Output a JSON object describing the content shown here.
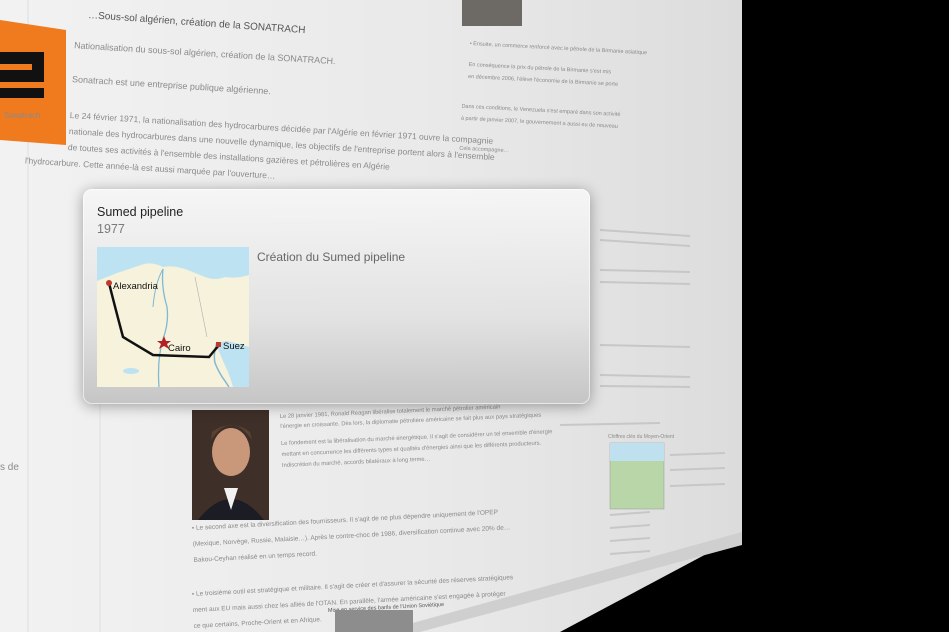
{
  "background": {
    "header_line": "…Sous-sol algérien, création de la SONATRACH",
    "logo_text": "Sonatrach",
    "paragraph_heading": "Nationalisation du sous-sol algérien, création de la SONATRACH.",
    "paragraph_intro": "Sonatrach est une entreprise publique algérienne.",
    "paragraph_lines": [
      "Le 24 février 1971, la nationalisation des hydrocarbures décidée par l'Algérie en février 1971 ouvre la compagnie",
      "nationale des hydrocarbures dans une nouvelle dynamique, les objectifs de l'entreprise portent alors à l'ensemble",
      "de toutes ses activités à l'ensemble des installations gazières et pétrolières en Algérie",
      "l'hydrocarbure. Cette année-là est aussi marquée par l'ouverture…"
    ],
    "reagan_lines": [
      "Le 28 janvier 1981, Ronald Reagan libéralise totalement le marché pétrolier américain",
      "l'énergie en croissante. Dès lors, la diplomatie pétrolière américaine se fait plus aux pays stratégiques",
      "Le fondement est la libéralisation du marché énergétique. Il s'agit de considérer un tel ensemble d'énergie",
      "mettant en concurrence les différents types et qualités d'énergies ainsi que les différents producteurs.",
      "Indiscrétion du marché, accords bilatéraux à long terme…"
    ],
    "bullet_lines_1": [
      "• Le second axe est la diversification des fournisseurs. Il s'agit de ne plus dépendre uniquement de l'OPEP",
      "(Mexique, Norvège, Russie, Malaisie…). Après le contre-choc de 1986, diversification continue avec 20% de…",
      "Bakou-Ceyhan réalisé en un temps record."
    ],
    "bullet_lines_2": [
      "• Le troisième outil est stratégique et militaire. Il s'agit de créer et d'assurer la sécurité des réserves stratégiques",
      "ment aux EU mais aussi chez les alliés de l'OTAN. En parallèle, l'armée américaine s'est engagée à protéger",
      "ce que certains, Proche-Orient et en Afrique."
    ],
    "right_col_lines": [
      "• Ensuite, un commerce renforcé avec le pétrole de la Birmanie asiatique",
      "En conséquence la prix du pétrole de la Birmanie s'est mis",
      "en décembre 2006, l'élève l'économie de la Birmanie se porte",
      "Dans ces conditions, le Venezuela s'est emparé dans son activité",
      "à partir de janvier 2007, le gouvernement a aussi eu de nouveau",
      "Cela accompagne…"
    ],
    "side_chart_caption": "Chiffres clés du Moyen-Orient",
    "small_caption": "Mise en service des barils de l'Union Soviétique",
    "left_edge_text": "s de"
  },
  "card": {
    "title": "Sumed pipeline",
    "year": "1977",
    "description": "Création du Sumed pipeline",
    "map": {
      "labels": {
        "alexandria": "Alexandria",
        "cairo": "Cairo",
        "suez": "Suez"
      },
      "colors": {
        "sea": "#bde3f2",
        "land": "#f6f2dc",
        "pipeline": "#111111",
        "city_dot": "#c0392b",
        "capital_star": "#b22222"
      }
    }
  }
}
